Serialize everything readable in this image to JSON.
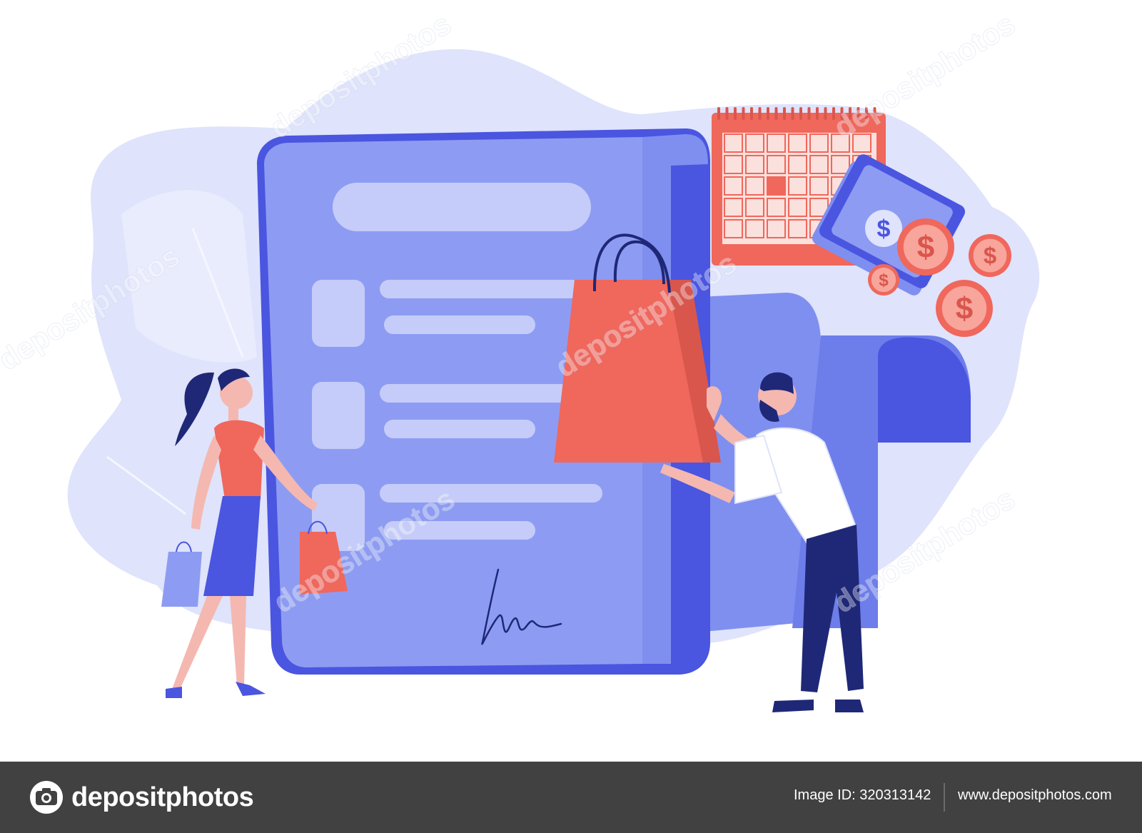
{
  "illustration": {
    "palette": {
      "background": "#ffffff",
      "blob": "#dfe3fb",
      "document": "#8d9cf2",
      "document_light": "#c5ccf9",
      "accent_blue": "#4a55e0",
      "coral": "#f0675c",
      "coral_light": "#f8a59c",
      "skin": "#f4b8b0",
      "navy": "#1f2877"
    },
    "watermark_text": "depositphotos",
    "icons": [
      "document-icon",
      "calendar-icon",
      "shopping-bag-icon",
      "banknote-icon",
      "coin-icon",
      "signature-icon",
      "woman-figure",
      "man-figure"
    ]
  },
  "footer": {
    "brand_name": "depositphotos",
    "image_id_text": "Image ID: 320313142",
    "site_url": "www.depositphotos.com"
  }
}
